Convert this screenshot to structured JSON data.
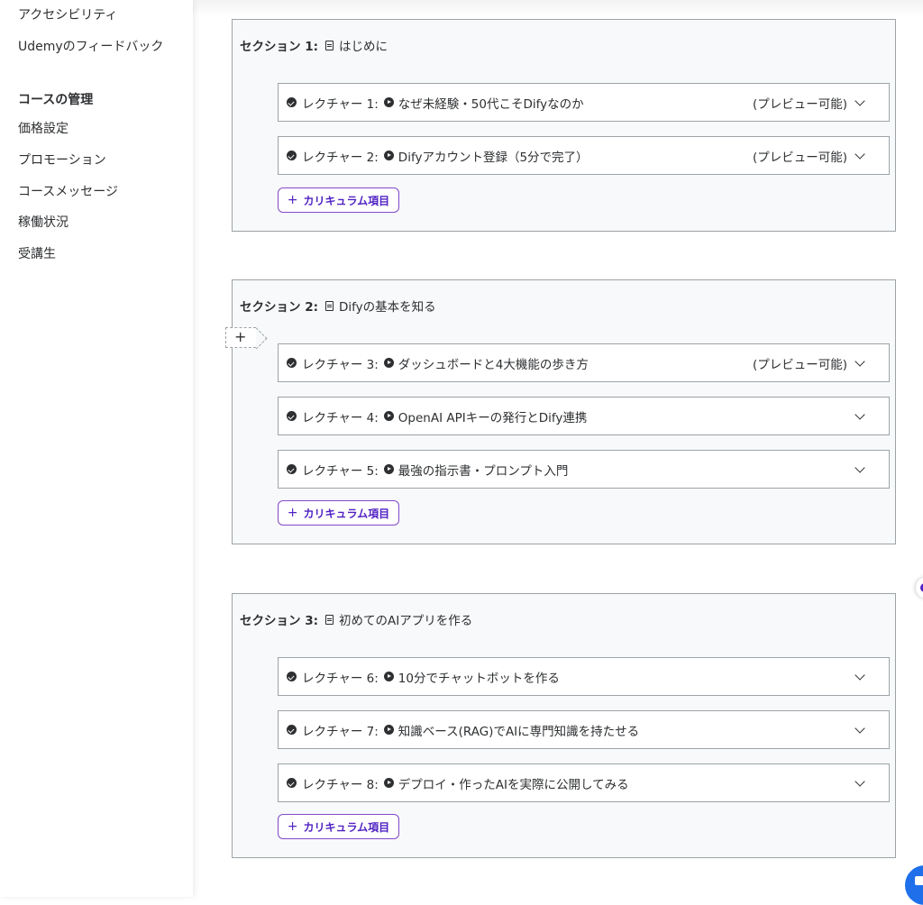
{
  "sidebar": {
    "items_top": [
      "アクセシビリティ",
      "Udemyのフィードバック"
    ],
    "management_heading": "コースの管理",
    "items": [
      "価格設定",
      "プロモーション",
      "コースメッセージ",
      "稼働状況",
      "受講生"
    ]
  },
  "curriculum": {
    "add_item_label": "カリキュラム項目",
    "sections": [
      {
        "label": "セクション 1:",
        "title": "はじめに",
        "lectures": [
          {
            "label": "レクチャー 1:",
            "title": "なぜ未経験・50代こそDifyなのか",
            "preview": "(プレビュー可能)"
          },
          {
            "label": "レクチャー 2:",
            "title": "Difyアカウント登録（5分で完了）",
            "preview": "(プレビュー可能)"
          }
        ]
      },
      {
        "label": "セクション 2:",
        "title": "Difyの基本を知る",
        "lectures": [
          {
            "label": "レクチャー 3:",
            "title": "ダッシュボードと4大機能の歩き方",
            "preview": "(プレビュー可能)"
          },
          {
            "label": "レクチャー 4:",
            "title": "OpenAI APIキーの発行とDify連携",
            "preview": ""
          },
          {
            "label": "レクチャー 5:",
            "title": "最強の指示書・プロンプト入門",
            "preview": ""
          }
        ]
      },
      {
        "label": "セクション 3:",
        "title": "初めてのAIアプリを作る",
        "lectures": [
          {
            "label": "レクチャー 6:",
            "title": "10分でチャットボットを作る",
            "preview": ""
          },
          {
            "label": "レクチャー 7:",
            "title": "知識ベース(RAG)でAIに専門知識を持たせる",
            "preview": ""
          },
          {
            "label": "レクチャー 8:",
            "title": "デプロイ・作ったAIを実際に公開してみる",
            "preview": ""
          }
        ]
      }
    ]
  },
  "colors": {
    "accent": "#5022c3",
    "border": "#9da3a7",
    "section_bg": "#f7f9fa",
    "text": "#2d2f31"
  }
}
